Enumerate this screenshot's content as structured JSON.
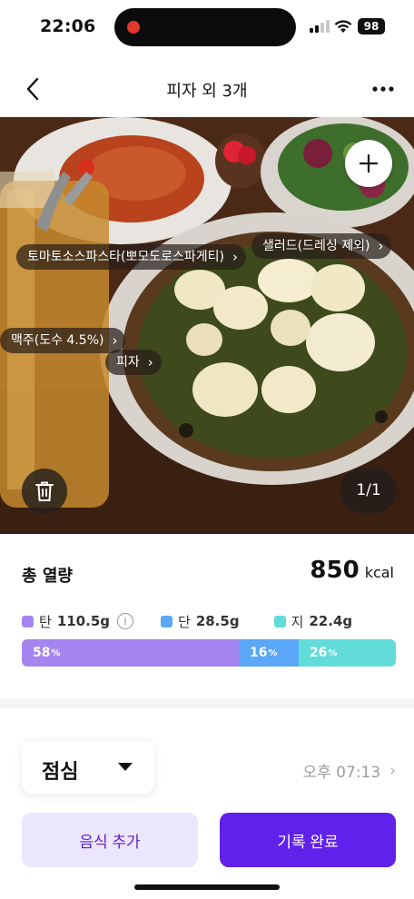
{
  "status_bar": {
    "time": "22:06",
    "battery": "98"
  },
  "nav": {
    "title": "피자 외 3개"
  },
  "photo": {
    "tags": [
      {
        "label": "토마토소스파스타(뽀모도로스파게티)"
      },
      {
        "label": "샐러드(드레싱 제외)"
      },
      {
        "label": "맥주(도수 4.5%)"
      },
      {
        "label": "피자"
      }
    ],
    "page_indicator": "1/1"
  },
  "nutrition": {
    "total_label": "총 열량",
    "total_value": "850",
    "total_unit": "kcal",
    "macros": [
      {
        "name": "탄",
        "value": "110.5g",
        "color": "#a585f0",
        "percent": 58,
        "percent_label": "58",
        "percent_sign": "%"
      },
      {
        "name": "단",
        "value": "28.5g",
        "color": "#5aa8f7",
        "percent": 16,
        "percent_label": "16",
        "percent_sign": "%"
      },
      {
        "name": "지",
        "value": "22.4g",
        "color": "#62dcd8",
        "percent": 26,
        "percent_label": "26",
        "percent_sign": "%"
      }
    ]
  },
  "meal": {
    "selected": "점심",
    "time": "오후 07:13"
  },
  "buttons": {
    "add_food": "음식 추가",
    "complete": "기록 완료"
  },
  "icons": {
    "back": "chevron-left-icon",
    "more": "more-dots-icon",
    "add_photo": "plus-icon",
    "delete": "trash-icon",
    "info": "info-icon"
  }
}
